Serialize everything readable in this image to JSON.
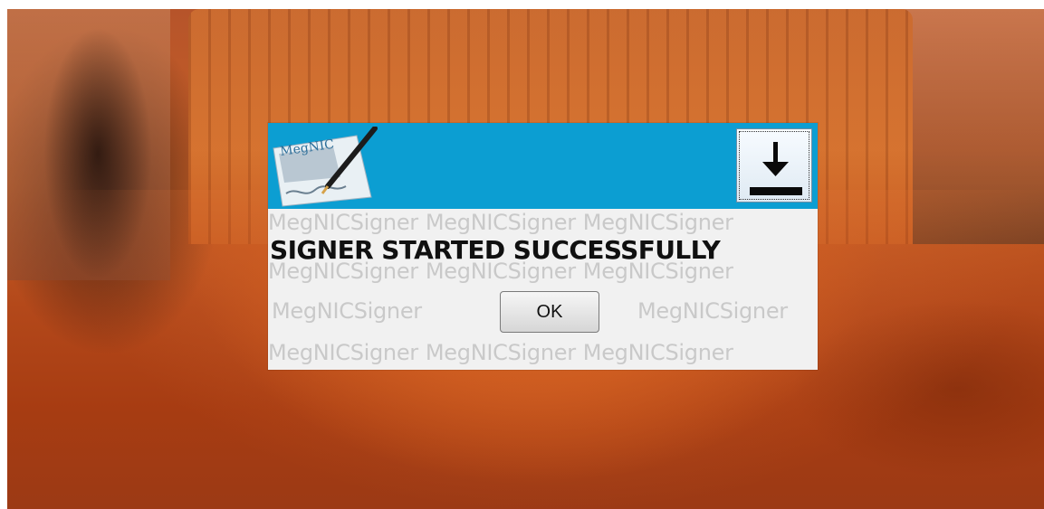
{
  "desktop": {
    "wallpaper": "desert-butte-wallpaper"
  },
  "dialog": {
    "header_color": "#0c9ed2",
    "logo_icon": "megnic-signature-pen-icon",
    "logo_text": "MegNIC",
    "download_icon": "download-arrow-icon",
    "watermark": "MegNICSigner",
    "message": "SIGNER STARTED SUCCESSFULLY",
    "ok_label": "OK"
  }
}
